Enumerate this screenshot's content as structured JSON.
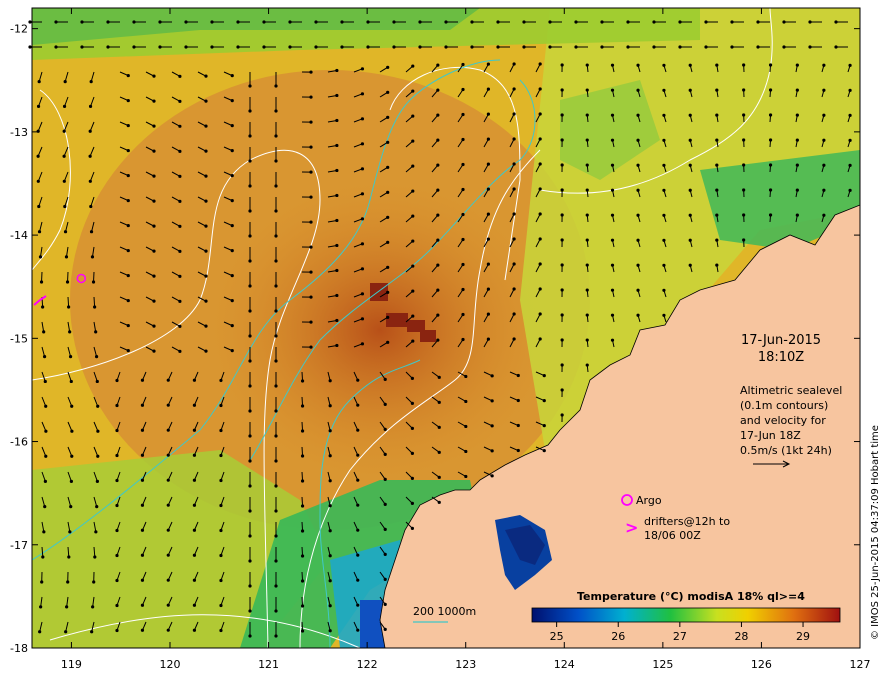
{
  "map": {
    "lon_ticks": [
      "119",
      "120",
      "121",
      "122",
      "123",
      "124",
      "125",
      "126",
      "127"
    ],
    "lat_ticks": [
      "-12",
      "-13",
      "-14",
      "-15",
      "-16",
      "-17",
      "-18"
    ],
    "lon_range": [
      118.6,
      127
    ],
    "lat_range": [
      -18,
      -11.8
    ]
  },
  "colors": {
    "land": "#f7c59f",
    "warm": "#c96a1c",
    "hot": "#8a2a10",
    "mid": "#e0c020",
    "cool": "#40c040",
    "cold": "#2080d0",
    "coldest": "#003090",
    "contour_sealevel": "#ffffff",
    "contour_bathymetry": "#40c8c8",
    "argo": "#ff00ff"
  },
  "annotations": {
    "date": "17-Jun-2015",
    "time": "18:10Z",
    "alt_lines": [
      "Altimetric sealevel",
      "(0.1m contours)",
      "and velocity for",
      "17-Jun 18Z",
      "0.5m/s (1kt 24h)"
    ],
    "argo_label": "Argo",
    "drifter_symbol": ">",
    "drifter_lines": [
      "drifters@12h to",
      "18/06 00Z"
    ],
    "scale_label": "200  1000m",
    "copyright": "© IMOS 25-Jun-2015 04:37:09 Hobart time"
  },
  "colorbar": {
    "title": "Temperature (°C) modisA 18% ql>=4",
    "ticks": [
      "25",
      "26",
      "27",
      "28",
      "29"
    ],
    "range": [
      24.6,
      29.6
    ]
  },
  "argo_float": {
    "lon": 119.1,
    "lat": -14.42
  }
}
